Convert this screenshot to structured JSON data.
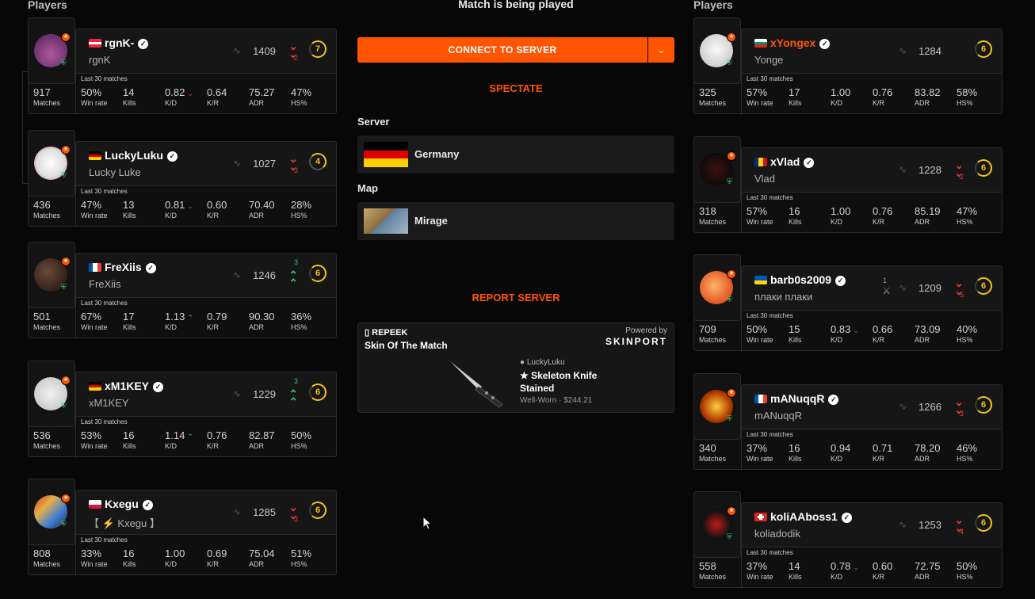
{
  "left_team": {
    "title": "Players",
    "players": [
      {
        "flag": "at",
        "nick": "rgnK-",
        "realname": "rgnK",
        "elo": "1409",
        "elo_trend": "down",
        "elo_change": "2",
        "level": "7",
        "last30": "Last 30 matches",
        "matches": "917",
        "winrate": "50%",
        "kills": "14",
        "kd": "0.82",
        "kd_dir": "down",
        "kr": "0.64",
        "adr": "75.27",
        "hs": "47%"
      },
      {
        "flag": "de",
        "nick": "LuckyLuku",
        "realname": "Lucky Luke",
        "elo": "1027",
        "elo_trend": "down",
        "elo_change": "3",
        "level": "4",
        "last30": "Last 30 matches",
        "matches": "436",
        "winrate": "47%",
        "kills": "13",
        "kd": "0.81",
        "kd_dir": "down",
        "kr": "0.60",
        "adr": "70.40",
        "hs": "28%"
      },
      {
        "flag": "fr",
        "nick": "FreXiis",
        "realname": "FreXiis",
        "elo": "1246",
        "elo_trend": "up",
        "elo_change": "3",
        "level": "6",
        "last30": "Last 30 matches",
        "matches": "501",
        "winrate": "67%",
        "kills": "17",
        "kd": "1.13",
        "kd_dir": "up",
        "kr": "0.79",
        "adr": "90.30",
        "hs": "36%"
      },
      {
        "flag": "de",
        "nick": "xM1KEY",
        "realname": "xM1KEY",
        "elo": "1229",
        "elo_trend": "up",
        "elo_change": "3",
        "level": "6",
        "last30": "Last 30 matches",
        "matches": "536",
        "winrate": "53%",
        "kills": "16",
        "kd": "1.14",
        "kd_dir": "up",
        "kr": "0.76",
        "adr": "82.87",
        "hs": "50%"
      },
      {
        "flag": "pl",
        "nick": "Kxegu",
        "realname": "【 ⚡ Kxegu 】",
        "elo": "1285",
        "elo_trend": "down",
        "elo_change": "3",
        "level": "6",
        "last30": "Last 30 matches",
        "matches": "808",
        "winrate": "33%",
        "kills": "16",
        "kd": "1.00",
        "kd_dir": "",
        "kr": "0.69",
        "adr": "75.04",
        "hs": "51%"
      }
    ]
  },
  "right_team": {
    "title": "Players",
    "players": [
      {
        "flag": "bg",
        "nick": "xYongex",
        "realname": "Yonge",
        "elo": "1284",
        "elo_trend": "",
        "elo_change": "",
        "level": "6",
        "last30": "Last 30 matches",
        "matches": "325",
        "winrate": "57%",
        "kills": "17",
        "kd": "1.00",
        "kd_dir": "",
        "kr": "0.76",
        "adr": "83.82",
        "hs": "58%"
      },
      {
        "flag": "ro",
        "nick": "xVlad",
        "realname": "Vlad",
        "elo": "1228",
        "elo_trend": "down",
        "elo_change": "2",
        "level": "6",
        "last30": "Last 30 matches",
        "matches": "318",
        "winrate": "57%",
        "kills": "16",
        "kd": "1.00",
        "kd_dir": "",
        "kr": "0.76",
        "adr": "85.19",
        "hs": "47%"
      },
      {
        "flag": "ua",
        "nick": "barb0s2009",
        "realname": "плаки плаки",
        "elo": "1209",
        "elo_trend": "down",
        "elo_change": "5",
        "level": "6",
        "party": "1",
        "last30": "Last 30 matches",
        "matches": "709",
        "winrate": "50%",
        "kills": "15",
        "kd": "0.83",
        "kd_dir": "down",
        "kr": "0.66",
        "adr": "73.09",
        "hs": "40%"
      },
      {
        "flag": "fr",
        "nick": "mANuqqR",
        "realname": "mANuqqR",
        "elo": "1266",
        "elo_trend": "down",
        "elo_change": "3",
        "level": "6",
        "last30": "Last 30 matches",
        "matches": "340",
        "winrate": "37%",
        "kills": "16",
        "kd": "0.94",
        "kd_dir": "",
        "kr": "0.71",
        "adr": "78.20",
        "hs": "46%"
      },
      {
        "flag": "ch",
        "nick": "koliAAboss1",
        "realname": "koliadodik",
        "elo": "1253",
        "elo_trend": "down",
        "elo_change": "4",
        "level": "6",
        "last30": "Last 30 matches",
        "matches": "558",
        "winrate": "37%",
        "kills": "14",
        "kd": "0.78",
        "kd_dir": "down",
        "kr": "0.60",
        "adr": "72.75",
        "hs": "50%"
      }
    ]
  },
  "stat_labels": {
    "matches": "Matches",
    "winrate": "Win rate",
    "kills": "Kills",
    "kd": "K/D",
    "kr": "K/R",
    "adr": "ADR",
    "hs": "HS%"
  },
  "center": {
    "status": "Match is being played",
    "connect_label": "CONNECT TO SERVER",
    "spectate_label": "SPECTATE",
    "server_label": "Server",
    "server_value": "Germany",
    "map_label": "Map",
    "map_value": "Mirage",
    "report_label": "REPORT SERVER"
  },
  "skin": {
    "brand": "REPEEK",
    "title": "Skin Of The Match",
    "powered_by": "Powered by",
    "sponsor": "SKINPORT",
    "owner": "LuckyLuku",
    "name_line1": "★ Skeleton Knife",
    "name_line2": "Stained",
    "meta": "Well-Worn · $244.21"
  },
  "colors": {
    "accent": "#ff5500",
    "level": "#f5c518",
    "down": "#e53935",
    "up": "#2ecc71"
  }
}
